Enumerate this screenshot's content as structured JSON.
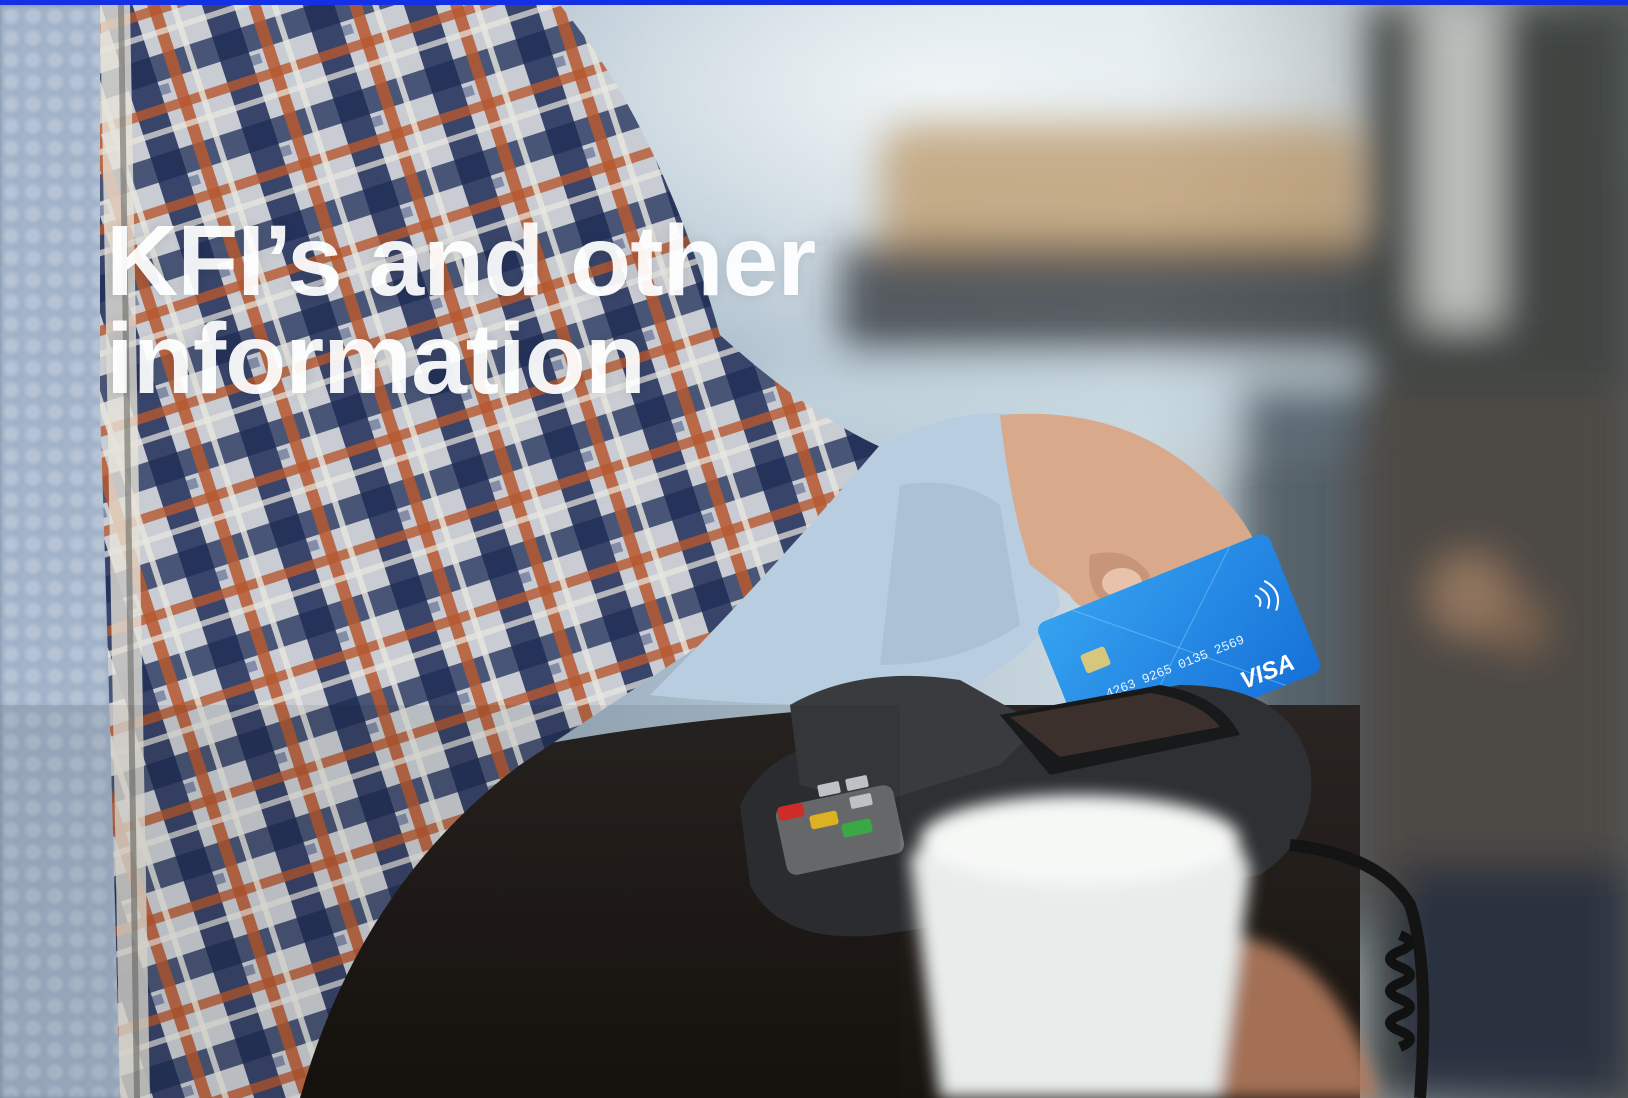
{
  "slide": {
    "title": "KFI’s and other\ninformation"
  },
  "image": {
    "description_icon": "photo-contactless-card-payment",
    "card_brand": "VISA",
    "card_number": "4263 9265 0135 2569"
  },
  "colors": {
    "accent_bar": "#1330e6",
    "title_text": "#ffffff",
    "card_blue": "#1d8ae6"
  }
}
